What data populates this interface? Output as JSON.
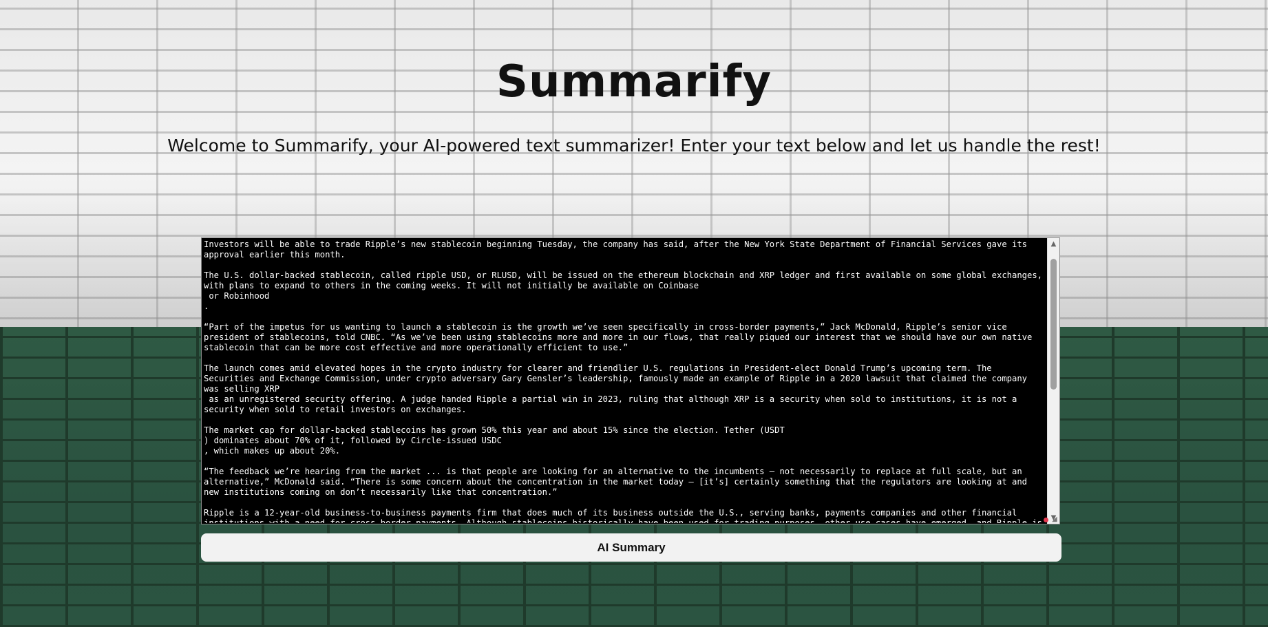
{
  "page": {
    "title": "Summarify",
    "subtitle": "Welcome to Summarify, your AI-powered text summarizer! Enter your text below and let us handle the rest!"
  },
  "editor": {
    "text": "Investors will be able to trade Ripple’s new stablecoin beginning Tuesday, the company has said, after the New York State Department of Financial Services gave its approval earlier this month.\n\nThe U.S. dollar-backed stablecoin, called ripple USD, or RLUSD, will be issued on the ethereum blockchain and XRP ledger and first available on some global exchanges, with plans to expand to others in the coming weeks. It will not initially be available on Coinbase\n or Robinhood\n.\n\n“Part of the impetus for us wanting to launch a stablecoin is the growth we’ve seen specifically in cross-border payments,” Jack McDonald, Ripple’s senior vice president of stablecoins, told CNBC. “As we’ve been using stablecoins more and more in our flows, that really piqued our interest that we should have our own native stablecoin that can be more cost effective and more operationally efficient to use.”\n\nThe launch comes amid elevated hopes in the crypto industry for clearer and friendlier U.S. regulations in President-elect Donald Trump’s upcoming term. The Securities and Exchange Commission, under crypto adversary Gary Gensler’s leadership, famously made an example of Ripple in a 2020 lawsuit that claimed the company was selling XRP\n as an unregistered security offering. A judge handed Ripple a partial win in 2023, ruling that although XRP is a security when sold to institutions, it is not a security when sold to retail investors on exchanges.\n\nThe market cap for dollar-backed stablecoins has grown 50% this year and about 15% since the election. Tether (USDT\n) dominates about 70% of it, followed by Circle-issued USDC\n, which makes up about 20%.\n\n“The feedback we’re hearing from the market ... is that people are looking for an alternative to the incumbents — not necessarily to replace at full scale, but an alternative,” McDonald said. “There is some concern about the concentration in the market today — [it’s] certainly something that the regulators are looking at and new institutions coming on don’t necessarily like that concentration.”\n\nRipple is a 12-year-old business-to-business payments firm that does much of its business outside the U.S., serving banks, payments companies and other financial institutions with a need for cross-border payments. Although stablecoins historically have been used for trading purposes, other use cases have emerged, and Ripple is"
  },
  "button": {
    "label": "AI Summary"
  }
}
